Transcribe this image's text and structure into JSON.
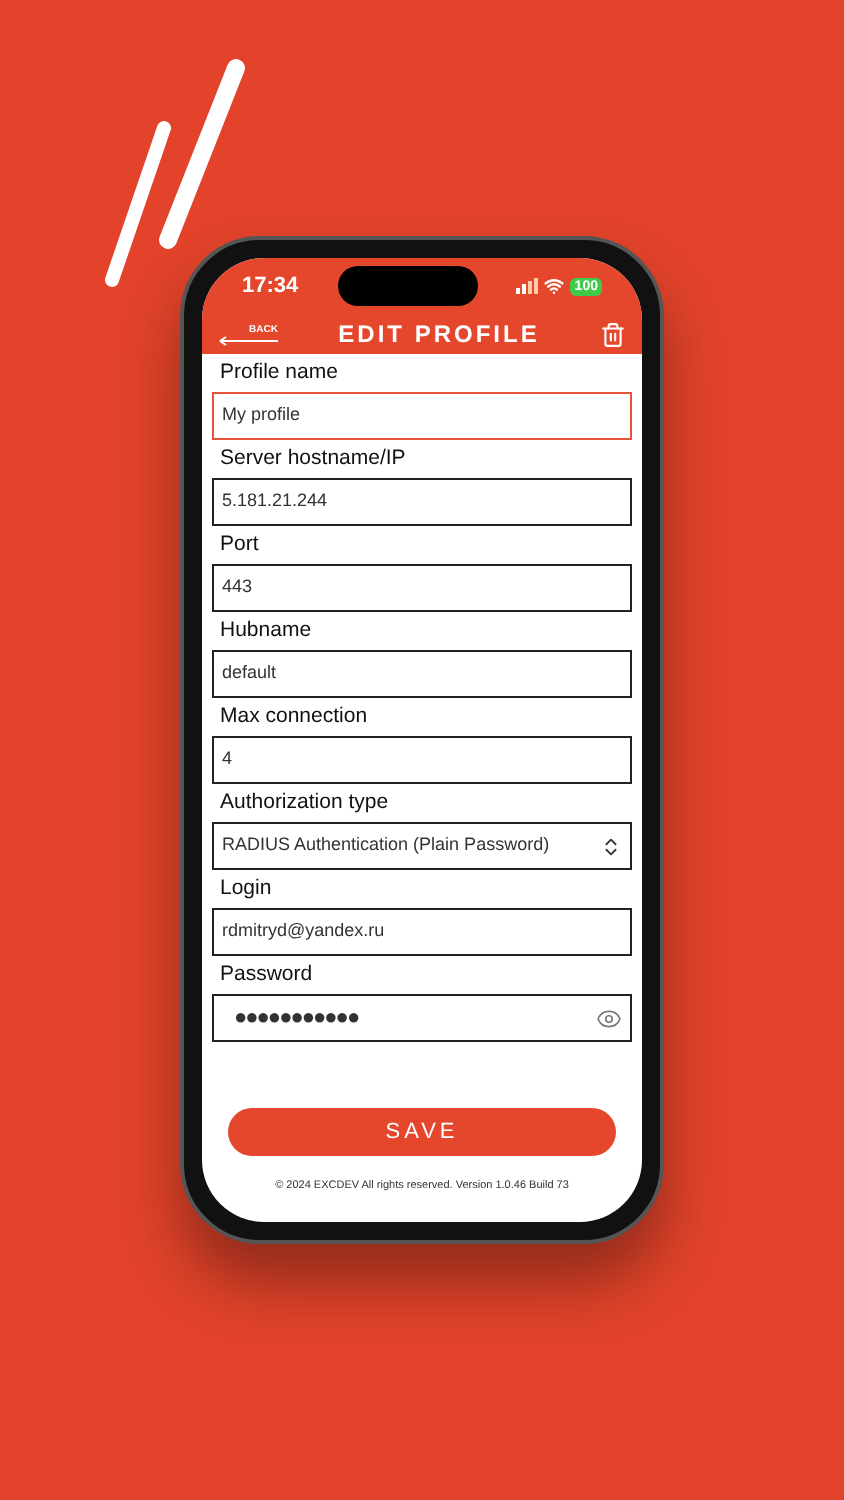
{
  "status_bar": {
    "time": "17:34",
    "battery": "100"
  },
  "nav": {
    "back": "BACK",
    "title": "EDIT PROFILE"
  },
  "fields": [
    {
      "kind": "text",
      "label": "Profile name",
      "value": "My profile",
      "focused": true
    },
    {
      "kind": "text",
      "label": "Server hostname/IP",
      "value": "5.181.21.244",
      "focused": false
    },
    {
      "kind": "text",
      "label": "Port",
      "value": "443",
      "focused": false
    },
    {
      "kind": "text",
      "label": "Hubname",
      "value": "default",
      "focused": false
    },
    {
      "kind": "text",
      "label": "Max connection",
      "value": "4",
      "focused": false
    },
    {
      "kind": "select",
      "label": "Authorization type",
      "value": "RADIUS Authentication (Plain Password)",
      "focused": false
    },
    {
      "kind": "text",
      "label": "Login",
      "value": "rdmitryd@yandex.ru",
      "focused": false
    },
    {
      "kind": "password",
      "label": "Password",
      "value": "●●●●●●●●●●●",
      "focused": false
    }
  ],
  "save_button": "SAVE",
  "footer": "© 2024 EXCDEV All rights reserved. Version 1.0.46 Build 73"
}
